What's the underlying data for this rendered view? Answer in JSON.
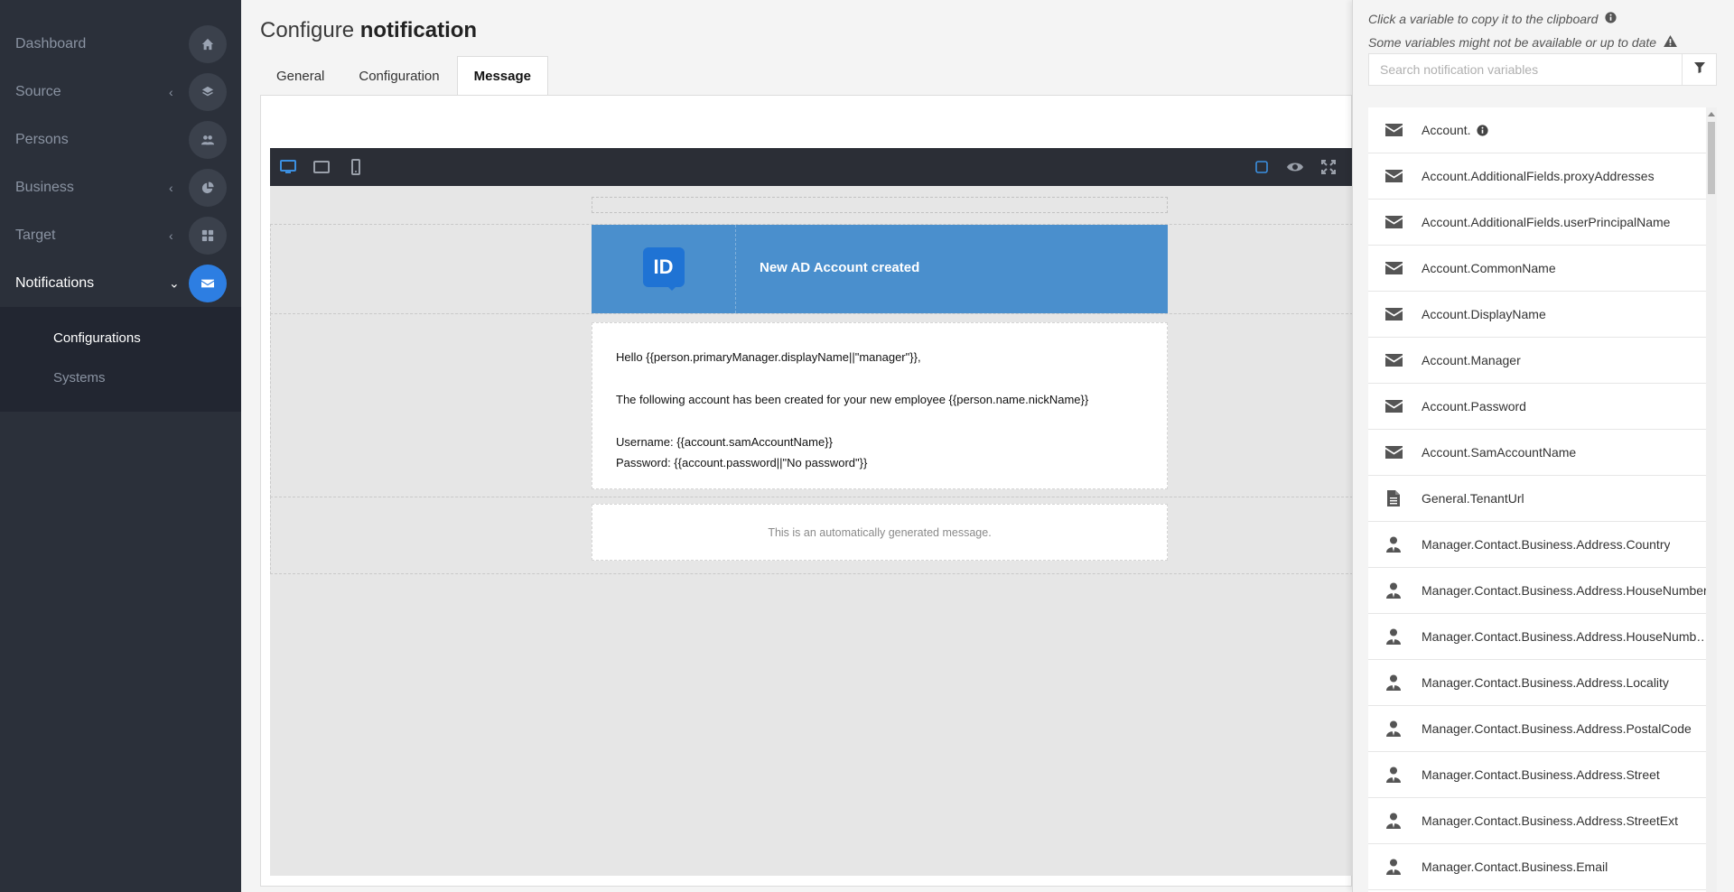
{
  "sidebar": {
    "items": [
      {
        "label": "Dashboard",
        "icon": "home-icon",
        "chevron": ""
      },
      {
        "label": "Source",
        "icon": "layers-icon",
        "chevron": "‹"
      },
      {
        "label": "Persons",
        "icon": "users-icon",
        "chevron": ""
      },
      {
        "label": "Business",
        "icon": "pie-chart-icon",
        "chevron": "‹"
      },
      {
        "label": "Target",
        "icon": "grid-icon",
        "chevron": "‹"
      },
      {
        "label": "Notifications",
        "icon": "envelope-icon",
        "chevron": "⌄",
        "active": true
      }
    ],
    "subitems": [
      {
        "label": "Configurations",
        "active": true
      },
      {
        "label": "Systems",
        "active": false
      }
    ]
  },
  "page": {
    "title_light": "Configure",
    "title_bold": "notification"
  },
  "tabs": [
    {
      "label": "General",
      "active": false
    },
    {
      "label": "Configuration",
      "active": false
    },
    {
      "label": "Message",
      "active": true
    }
  ],
  "email": {
    "logo_text": "ID",
    "header_title": "New AD Account created",
    "greeting": "Hello {{person.primaryManager.displayName||\"manager\"}},",
    "intro": "The following account has been created for your new employee {{person.name.nickName}}",
    "username_line": "Username: {{account.samAccountName}}",
    "password_line": "Password: {{account.password||\"No password\"}}",
    "footer": "This is an automatically generated message."
  },
  "right_panel": {
    "hint_copy": "Click a variable to copy it to the clipboard",
    "hint_warning": "Some variables might not be available or up to date",
    "search_placeholder": "Search notification variables",
    "variables": [
      {
        "label": "Account.",
        "icon": "envelope-icon",
        "info": true
      },
      {
        "label": "Account.AdditionalFields.proxyAddresses",
        "icon": "envelope-icon"
      },
      {
        "label": "Account.AdditionalFields.userPrincipalName",
        "icon": "envelope-icon"
      },
      {
        "label": "Account.CommonName",
        "icon": "envelope-icon"
      },
      {
        "label": "Account.DisplayName",
        "icon": "envelope-icon"
      },
      {
        "label": "Account.Manager",
        "icon": "envelope-icon"
      },
      {
        "label": "Account.Password",
        "icon": "envelope-icon"
      },
      {
        "label": "Account.SamAccountName",
        "icon": "envelope-icon"
      },
      {
        "label": "General.TenantUrl",
        "icon": "file-icon"
      },
      {
        "label": "Manager.Contact.Business.Address.Country",
        "icon": "person-icon"
      },
      {
        "label": "Manager.Contact.Business.Address.HouseNumber",
        "icon": "person-icon"
      },
      {
        "label": "Manager.Contact.Business.Address.HouseNumb…",
        "icon": "person-icon"
      },
      {
        "label": "Manager.Contact.Business.Address.Locality",
        "icon": "person-icon"
      },
      {
        "label": "Manager.Contact.Business.Address.PostalCode",
        "icon": "person-icon"
      },
      {
        "label": "Manager.Contact.Business.Address.Street",
        "icon": "person-icon"
      },
      {
        "label": "Manager.Contact.Business.Address.StreetExt",
        "icon": "person-icon"
      },
      {
        "label": "Manager.Contact.Business.Email",
        "icon": "person-icon"
      }
    ]
  },
  "colors": {
    "sidebar_bg": "#2b303a",
    "accent": "#2d7ee2",
    "email_header": "#4a8fcd",
    "editor_toolbar": "#2b2e36"
  }
}
